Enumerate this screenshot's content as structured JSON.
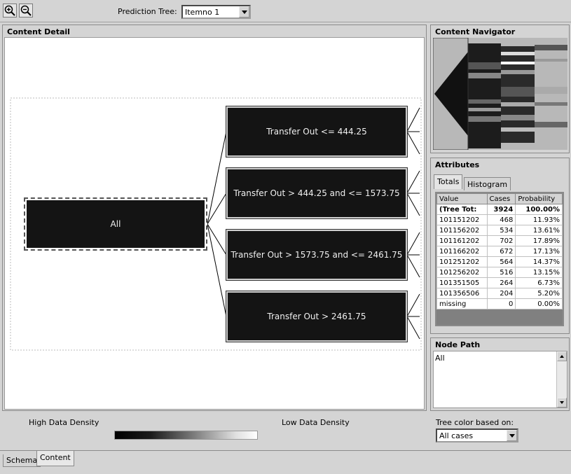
{
  "toolbar": {
    "zoom_in_icon": "zoom-in-icon",
    "zoom_out_icon": "zoom-out-icon",
    "prediction_tree_label": "Prediction Tree:",
    "prediction_tree_value": "Itemno 1"
  },
  "content_detail": {
    "title": "Content Detail",
    "nodes": {
      "root": "All",
      "n1": "Transfer Out <= 444.25",
      "n2": "Transfer Out > 444.25 and <= 1573.75",
      "n3": "Transfer Out > 1573.75 and <= 2461.75",
      "n4": "Transfer Out > 2461.75"
    }
  },
  "content_navigator": {
    "title": "Content Navigator"
  },
  "attributes": {
    "title": "Attributes",
    "tabs": [
      "Totals",
      "Histogram"
    ],
    "columns": [
      "Value",
      "Cases",
      "Probability"
    ],
    "rows": [
      {
        "value": "(Tree Tot:",
        "cases": "3924",
        "probability": "100.00%"
      },
      {
        "value": "101151202",
        "cases": "468",
        "probability": "11.93%"
      },
      {
        "value": "101156202",
        "cases": "534",
        "probability": "13.61%"
      },
      {
        "value": "101161202",
        "cases": "702",
        "probability": "17.89%"
      },
      {
        "value": "101166202",
        "cases": "672",
        "probability": "17.13%"
      },
      {
        "value": "101251202",
        "cases": "564",
        "probability": "14.37%"
      },
      {
        "value": "101256202",
        "cases": "516",
        "probability": "13.15%"
      },
      {
        "value": "101351505",
        "cases": "264",
        "probability": "6.73%"
      },
      {
        "value": "101356506",
        "cases": "204",
        "probability": "5.20%"
      },
      {
        "value": "missing",
        "cases": "0",
        "probability": "0.00%"
      }
    ]
  },
  "node_path": {
    "title": "Node Path",
    "value": "All"
  },
  "legend": {
    "high_label": "High Data Density",
    "low_label": "Low Data Density",
    "color_based_label": "Tree color based on:",
    "color_based_value": "All cases"
  },
  "bottom_tabs": {
    "schema": "Schema",
    "content": "Content"
  }
}
